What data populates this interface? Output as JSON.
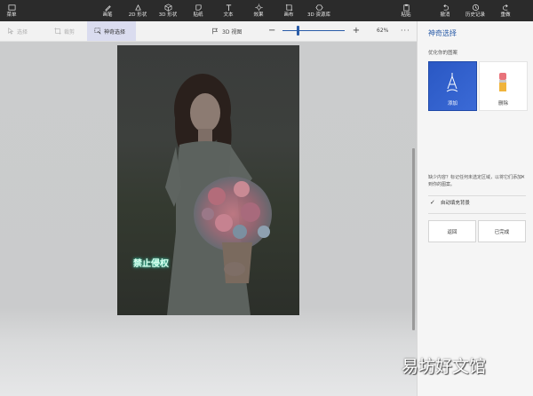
{
  "toolbar": {
    "menu_label": "菜单",
    "tools": [
      {
        "label": "画笔",
        "icon": "brush-icon"
      },
      {
        "label": "2D 形状",
        "icon": "2d-shape-icon"
      },
      {
        "label": "3D 形状",
        "icon": "3d-shape-icon"
      },
      {
        "label": "贴纸",
        "icon": "sticker-icon"
      },
      {
        "label": "文本",
        "icon": "text-icon"
      },
      {
        "label": "效果",
        "icon": "effects-icon"
      },
      {
        "label": "画布",
        "icon": "canvas-icon"
      },
      {
        "label": "3D 资源库",
        "icon": "3d-library-icon"
      }
    ],
    "right": [
      {
        "label": "粘贴",
        "icon": "paste-icon"
      },
      {
        "label": "撤消",
        "icon": "undo-icon"
      },
      {
        "label": "历史记录",
        "icon": "history-icon"
      },
      {
        "label": "重做",
        "icon": "redo-icon"
      }
    ]
  },
  "subbar": {
    "select_label": "选择",
    "crop_label": "裁剪",
    "magic_select_label": "神奇选择",
    "view3d_label": "3D 视图",
    "zoom_minus": "−",
    "zoom_plus": "+",
    "zoom_percent": "62%",
    "zoom_level": 0.25,
    "more_label": "···"
  },
  "canvas": {
    "watermark_text": "禁止侵权"
  },
  "panel": {
    "title": "神奇选择",
    "subtitle": "优化你的图案",
    "add_label": "添加",
    "erase_label": "删除",
    "hint": "缺少内容？标记任何未选定区域，以将它们添加到你的图案。",
    "close": "✕",
    "autofill_label": "自动填充背景",
    "autofill_checked": true,
    "back_label": "返回",
    "done_label": "已完成"
  },
  "site_watermark": "易坊好文馆",
  "colors": {
    "accent": "#2a5ca8",
    "toolbar_bg": "#2b2b2b",
    "active_tab_bg": "#dadcef"
  }
}
